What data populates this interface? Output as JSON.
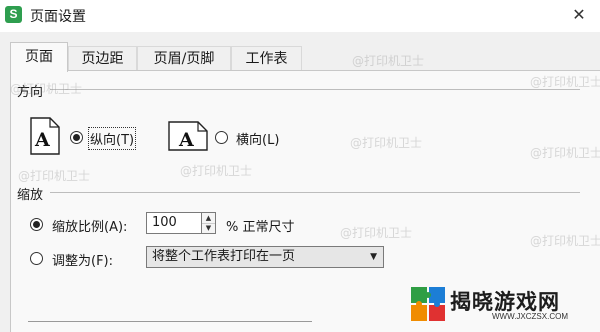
{
  "window": {
    "app_icon_letter": "S",
    "title": "页面设置",
    "close_glyph": "✕"
  },
  "tabs": [
    {
      "label": "页面",
      "active": true
    },
    {
      "label": "页边距",
      "active": false
    },
    {
      "label": "页眉/页脚",
      "active": false
    },
    {
      "label": "工作表",
      "active": false
    }
  ],
  "orientation": {
    "group_label": "方向",
    "portrait": {
      "icon_letter": "A",
      "label": "纵向(T)",
      "selected": true
    },
    "landscape": {
      "icon_letter": "A",
      "label": "横向(L)",
      "selected": false
    }
  },
  "scaling": {
    "group_label": "缩放",
    "zoom": {
      "label": "缩放比例(A):",
      "value": "100",
      "suffix": "% 正常尺寸",
      "selected": true
    },
    "fit": {
      "label": "调整为(F):",
      "selected": false,
      "dropdown_value": "将整个工作表打印在一页"
    }
  },
  "watermark_text": "@打印机卫士",
  "brand": {
    "name": "揭晓游戏网",
    "url": "WWW.JXCZSX.COM"
  }
}
